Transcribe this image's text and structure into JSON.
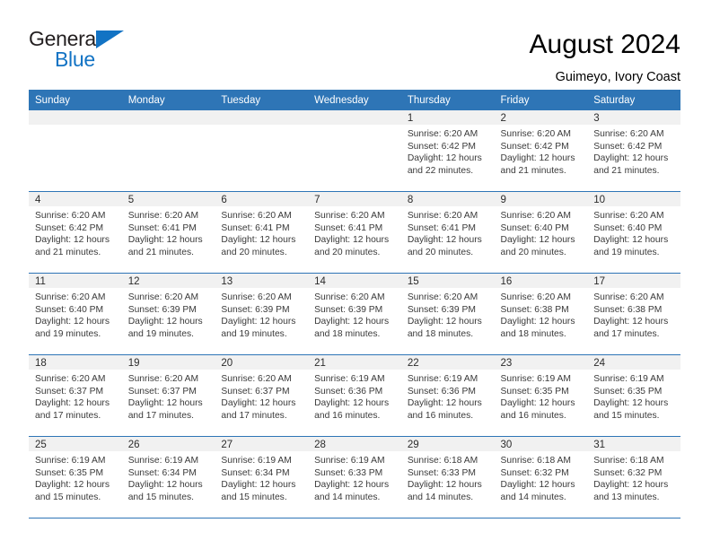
{
  "logo": {
    "word_top": "General",
    "word_bottom": "Blue",
    "triangle_color": "#1273c4",
    "icon": "general-blue-logo"
  },
  "header": {
    "title": "August 2024",
    "subtitle": "Guimeyo, Ivory Coast"
  },
  "theme": {
    "header_bg": "#2e75b6",
    "header_text": "#ffffff",
    "daynum_bg": "#f1f1f1",
    "rule": "#2e75b6"
  },
  "columns": [
    "Sunday",
    "Monday",
    "Tuesday",
    "Wednesday",
    "Thursday",
    "Friday",
    "Saturday"
  ],
  "weeks": [
    [
      {
        "day": "",
        "lines": []
      },
      {
        "day": "",
        "lines": []
      },
      {
        "day": "",
        "lines": []
      },
      {
        "day": "",
        "lines": []
      },
      {
        "day": "1",
        "lines": [
          "Sunrise: 6:20 AM",
          "Sunset: 6:42 PM",
          "Daylight: 12 hours",
          "and 22 minutes."
        ]
      },
      {
        "day": "2",
        "lines": [
          "Sunrise: 6:20 AM",
          "Sunset: 6:42 PM",
          "Daylight: 12 hours",
          "and 21 minutes."
        ]
      },
      {
        "day": "3",
        "lines": [
          "Sunrise: 6:20 AM",
          "Sunset: 6:42 PM",
          "Daylight: 12 hours",
          "and 21 minutes."
        ]
      }
    ],
    [
      {
        "day": "4",
        "lines": [
          "Sunrise: 6:20 AM",
          "Sunset: 6:42 PM",
          "Daylight: 12 hours",
          "and 21 minutes."
        ]
      },
      {
        "day": "5",
        "lines": [
          "Sunrise: 6:20 AM",
          "Sunset: 6:41 PM",
          "Daylight: 12 hours",
          "and 21 minutes."
        ]
      },
      {
        "day": "6",
        "lines": [
          "Sunrise: 6:20 AM",
          "Sunset: 6:41 PM",
          "Daylight: 12 hours",
          "and 20 minutes."
        ]
      },
      {
        "day": "7",
        "lines": [
          "Sunrise: 6:20 AM",
          "Sunset: 6:41 PM",
          "Daylight: 12 hours",
          "and 20 minutes."
        ]
      },
      {
        "day": "8",
        "lines": [
          "Sunrise: 6:20 AM",
          "Sunset: 6:41 PM",
          "Daylight: 12 hours",
          "and 20 minutes."
        ]
      },
      {
        "day": "9",
        "lines": [
          "Sunrise: 6:20 AM",
          "Sunset: 6:40 PM",
          "Daylight: 12 hours",
          "and 20 minutes."
        ]
      },
      {
        "day": "10",
        "lines": [
          "Sunrise: 6:20 AM",
          "Sunset: 6:40 PM",
          "Daylight: 12 hours",
          "and 19 minutes."
        ]
      }
    ],
    [
      {
        "day": "11",
        "lines": [
          "Sunrise: 6:20 AM",
          "Sunset: 6:40 PM",
          "Daylight: 12 hours",
          "and 19 minutes."
        ]
      },
      {
        "day": "12",
        "lines": [
          "Sunrise: 6:20 AM",
          "Sunset: 6:39 PM",
          "Daylight: 12 hours",
          "and 19 minutes."
        ]
      },
      {
        "day": "13",
        "lines": [
          "Sunrise: 6:20 AM",
          "Sunset: 6:39 PM",
          "Daylight: 12 hours",
          "and 19 minutes."
        ]
      },
      {
        "day": "14",
        "lines": [
          "Sunrise: 6:20 AM",
          "Sunset: 6:39 PM",
          "Daylight: 12 hours",
          "and 18 minutes."
        ]
      },
      {
        "day": "15",
        "lines": [
          "Sunrise: 6:20 AM",
          "Sunset: 6:39 PM",
          "Daylight: 12 hours",
          "and 18 minutes."
        ]
      },
      {
        "day": "16",
        "lines": [
          "Sunrise: 6:20 AM",
          "Sunset: 6:38 PM",
          "Daylight: 12 hours",
          "and 18 minutes."
        ]
      },
      {
        "day": "17",
        "lines": [
          "Sunrise: 6:20 AM",
          "Sunset: 6:38 PM",
          "Daylight: 12 hours",
          "and 17 minutes."
        ]
      }
    ],
    [
      {
        "day": "18",
        "lines": [
          "Sunrise: 6:20 AM",
          "Sunset: 6:37 PM",
          "Daylight: 12 hours",
          "and 17 minutes."
        ]
      },
      {
        "day": "19",
        "lines": [
          "Sunrise: 6:20 AM",
          "Sunset: 6:37 PM",
          "Daylight: 12 hours",
          "and 17 minutes."
        ]
      },
      {
        "day": "20",
        "lines": [
          "Sunrise: 6:20 AM",
          "Sunset: 6:37 PM",
          "Daylight: 12 hours",
          "and 17 minutes."
        ]
      },
      {
        "day": "21",
        "lines": [
          "Sunrise: 6:19 AM",
          "Sunset: 6:36 PM",
          "Daylight: 12 hours",
          "and 16 minutes."
        ]
      },
      {
        "day": "22",
        "lines": [
          "Sunrise: 6:19 AM",
          "Sunset: 6:36 PM",
          "Daylight: 12 hours",
          "and 16 minutes."
        ]
      },
      {
        "day": "23",
        "lines": [
          "Sunrise: 6:19 AM",
          "Sunset: 6:35 PM",
          "Daylight: 12 hours",
          "and 16 minutes."
        ]
      },
      {
        "day": "24",
        "lines": [
          "Sunrise: 6:19 AM",
          "Sunset: 6:35 PM",
          "Daylight: 12 hours",
          "and 15 minutes."
        ]
      }
    ],
    [
      {
        "day": "25",
        "lines": [
          "Sunrise: 6:19 AM",
          "Sunset: 6:35 PM",
          "Daylight: 12 hours",
          "and 15 minutes."
        ]
      },
      {
        "day": "26",
        "lines": [
          "Sunrise: 6:19 AM",
          "Sunset: 6:34 PM",
          "Daylight: 12 hours",
          "and 15 minutes."
        ]
      },
      {
        "day": "27",
        "lines": [
          "Sunrise: 6:19 AM",
          "Sunset: 6:34 PM",
          "Daylight: 12 hours",
          "and 15 minutes."
        ]
      },
      {
        "day": "28",
        "lines": [
          "Sunrise: 6:19 AM",
          "Sunset: 6:33 PM",
          "Daylight: 12 hours",
          "and 14 minutes."
        ]
      },
      {
        "day": "29",
        "lines": [
          "Sunrise: 6:18 AM",
          "Sunset: 6:33 PM",
          "Daylight: 12 hours",
          "and 14 minutes."
        ]
      },
      {
        "day": "30",
        "lines": [
          "Sunrise: 6:18 AM",
          "Sunset: 6:32 PM",
          "Daylight: 12 hours",
          "and 14 minutes."
        ]
      },
      {
        "day": "31",
        "lines": [
          "Sunrise: 6:18 AM",
          "Sunset: 6:32 PM",
          "Daylight: 12 hours",
          "and 13 minutes."
        ]
      }
    ]
  ]
}
